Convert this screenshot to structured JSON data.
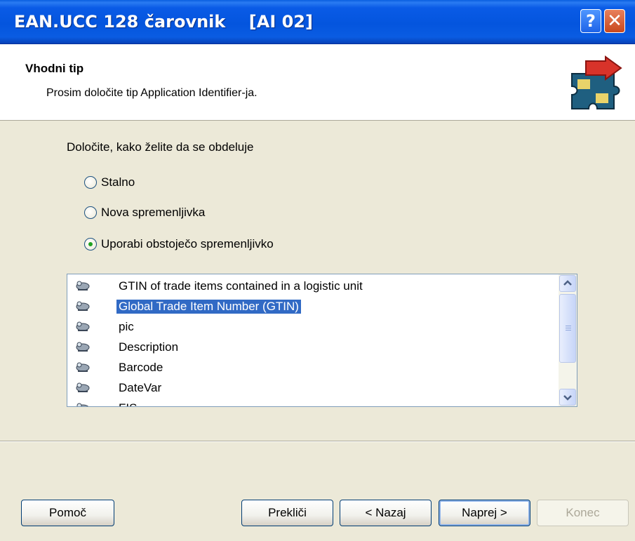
{
  "window": {
    "title": "EAN.UCC 128 čarovnik    [AI 02]",
    "help_button": "?",
    "close_button": "✕"
  },
  "header": {
    "title": "Vhodni tip",
    "subtitle": "Prosim določite tip Application Identifier-ja.",
    "icon": "puzzle-icon"
  },
  "prompt": "Določite, kako želite da se obdeluje",
  "radios": [
    {
      "label": "Stalno",
      "checked": false
    },
    {
      "label": "Nova spremenljivka",
      "checked": false
    },
    {
      "label": "Uporabi obstoječo spremenljivko",
      "checked": true
    }
  ],
  "list": {
    "items": [
      {
        "label": "GTIN of trade items contained in a logistic unit",
        "selected": false
      },
      {
        "label": "Global Trade Item Number (GTIN)",
        "selected": true
      },
      {
        "label": "pic",
        "selected": false
      },
      {
        "label": "Description",
        "selected": false
      },
      {
        "label": "Barcode",
        "selected": false
      },
      {
        "label": "DateVar",
        "selected": false
      },
      {
        "label": "FIS",
        "selected": false
      }
    ],
    "item_icon": "variable-icon"
  },
  "buttons": {
    "help": "Pomoč",
    "cancel": "Prekliči",
    "back": "< Nazaj",
    "next": "Naprej >",
    "finish": "Konec"
  },
  "colors": {
    "titlebar": "#0455de",
    "selection": "#316ac5",
    "dialog_bg": "#ece9d8"
  }
}
